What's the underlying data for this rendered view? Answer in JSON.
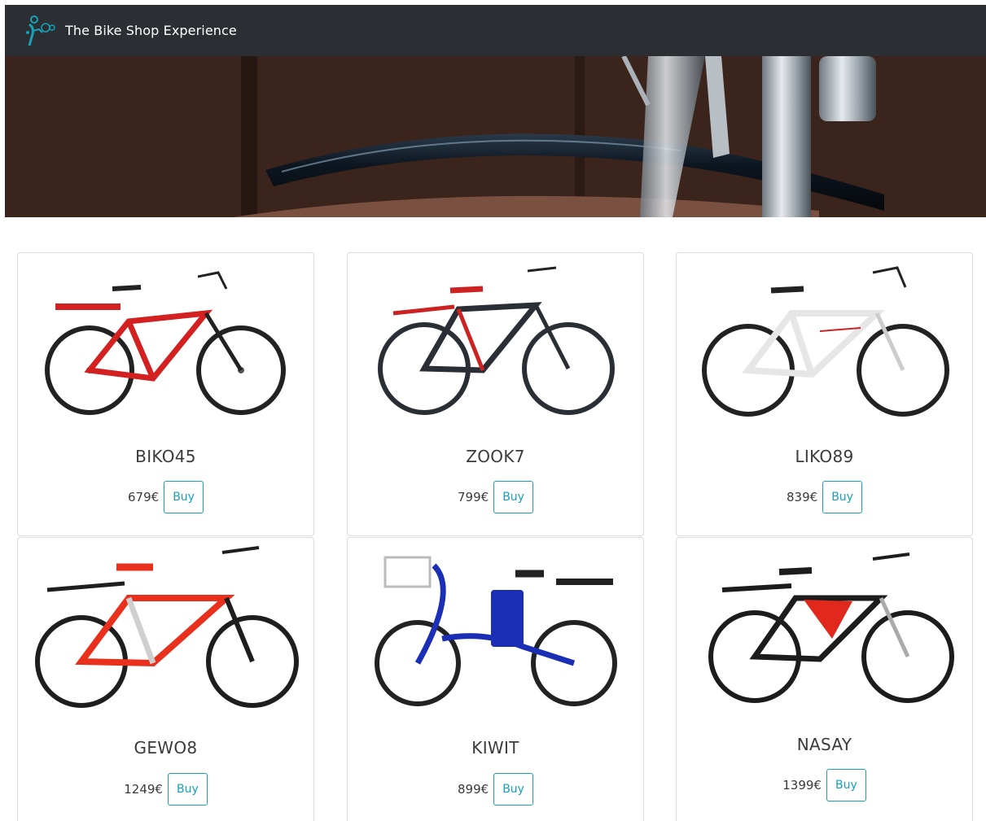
{
  "header": {
    "brand": "The Bike Shop Experience",
    "logo_icon": "bicycle-logo-icon",
    "accent_color": "#17a2b8",
    "background": "#2b2f33"
  },
  "hero": {
    "image": "bicycle-fender-photo"
  },
  "products": [
    {
      "name": "BIKO45",
      "price": "679€",
      "buy_label": "Buy",
      "frame_color": "#d32020",
      "accent": "#222222"
    },
    {
      "name": "ZOOK7",
      "price": "799€",
      "buy_label": "Buy",
      "frame_color": "#2a2f36",
      "accent": "#cc2222"
    },
    {
      "name": "LIKO89",
      "price": "839€",
      "buy_label": "Buy",
      "frame_color": "#f2f2f2",
      "accent": "#cc2222"
    },
    {
      "name": "GEWO8",
      "price": "1249€",
      "buy_label": "Buy",
      "frame_color": "#e8301c",
      "accent": "#cfcfcf"
    },
    {
      "name": "KIWIT",
      "price": "899€",
      "buy_label": "Buy",
      "frame_color": "#1a2fb5",
      "accent": "#d0d0d0"
    },
    {
      "name": "NASAY",
      "price": "1399€",
      "buy_label": "Buy",
      "frame_color": "#e0281c",
      "accent": "#1c1c1c"
    }
  ]
}
